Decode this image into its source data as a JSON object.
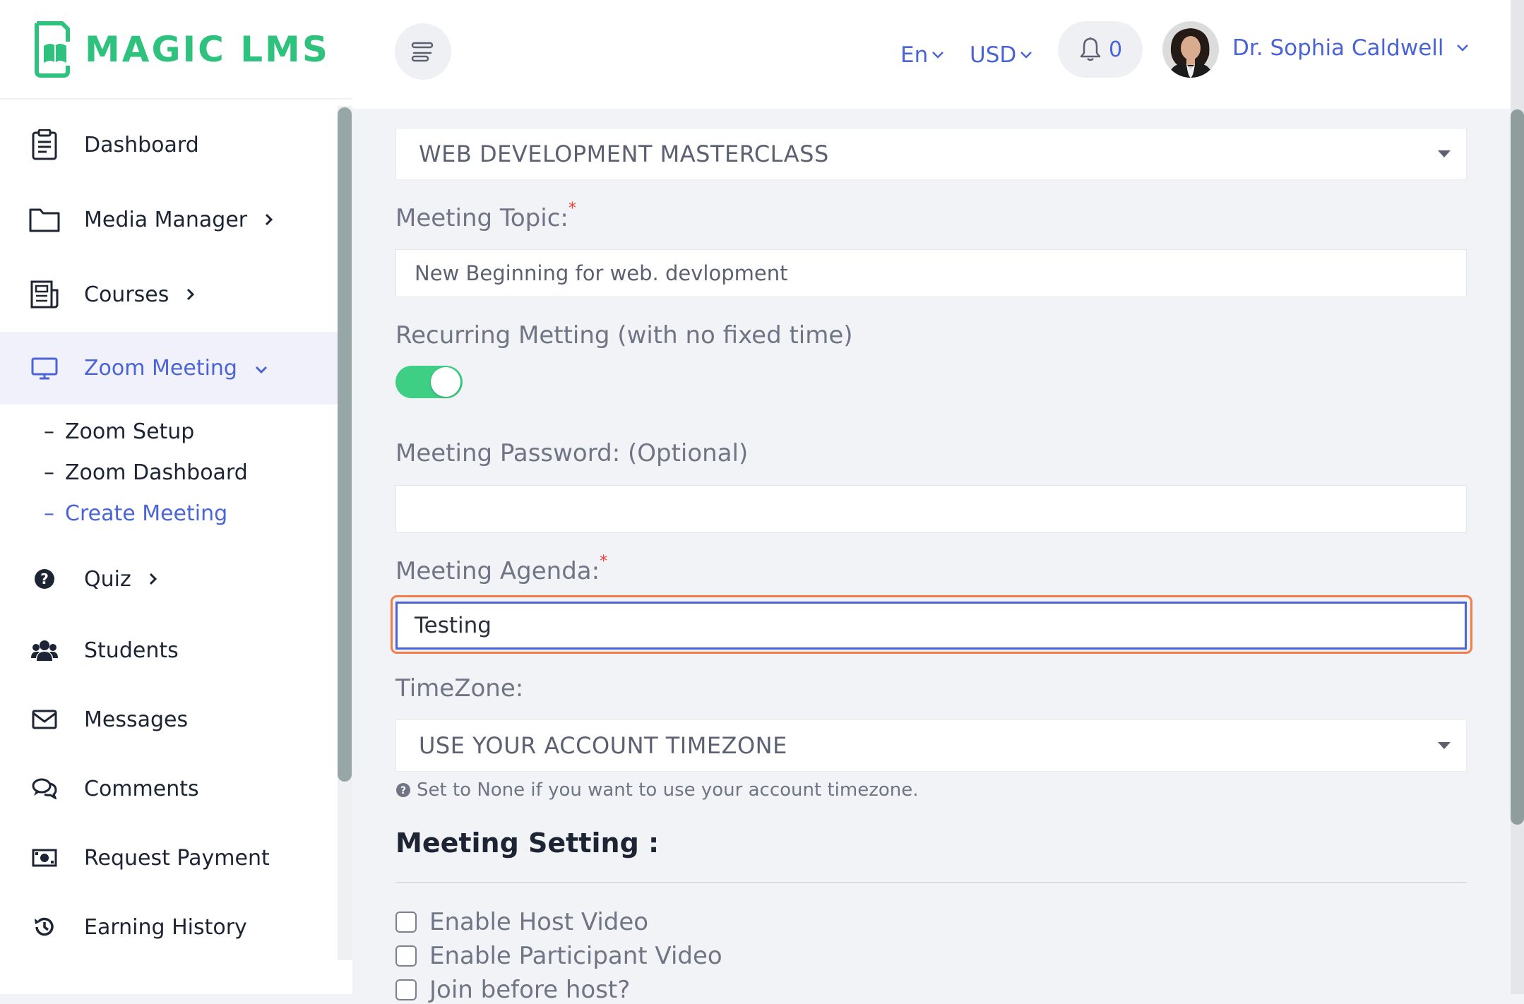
{
  "brand": {
    "name": "MAGIC LMS",
    "color": "#2ec27e"
  },
  "accent": "#4a64d8",
  "sidebar": {
    "items": [
      {
        "label": "Dashboard",
        "icon": "clipboard-icon"
      },
      {
        "label": "Media Manager",
        "icon": "folder-icon",
        "has_children": true
      },
      {
        "label": "Courses",
        "icon": "newspaper-icon",
        "has_children": true
      },
      {
        "label": "Zoom Meeting",
        "icon": "monitor-icon",
        "has_children": true,
        "expanded": true,
        "active": true
      },
      {
        "label": "Quiz",
        "icon": "question-circle-icon",
        "has_children": true
      },
      {
        "label": "Students",
        "icon": "users-icon"
      },
      {
        "label": "Messages",
        "icon": "envelope-icon"
      },
      {
        "label": "Comments",
        "icon": "comments-icon"
      },
      {
        "label": "Request Payment",
        "icon": "money-bill-icon"
      },
      {
        "label": "Earning History",
        "icon": "history-icon"
      }
    ],
    "zoom_submenu": [
      {
        "label": "Zoom Setup",
        "dash": "–"
      },
      {
        "label": "Zoom Dashboard",
        "dash": "–"
      },
      {
        "label": "Create Meeting",
        "dash": "–",
        "current": true
      }
    ]
  },
  "header": {
    "language": "En",
    "currency": "USD",
    "notification_count": "0",
    "user_name": "Dr. Sophia Caldwell"
  },
  "form": {
    "course_select": {
      "value": "WEB DEVELOPMENT MASTERCLASS"
    },
    "topic": {
      "label": "Meeting Topic:",
      "required_mark": "*",
      "value": "New Beginning for web. devlopment"
    },
    "recurring": {
      "label": "Recurring Metting (with no fixed time)",
      "enabled": true
    },
    "password": {
      "label": "Meeting Password: (Optional)",
      "value": ""
    },
    "agenda": {
      "label": "Meeting Agenda:",
      "required_mark": "*",
      "value": "Testing"
    },
    "timezone": {
      "label": "TimeZone:",
      "value": "USE YOUR ACCOUNT TIMEZONE",
      "hint": "Set to None if you want to use your account timezone."
    },
    "settings": {
      "title": "Meeting Setting :",
      "options": [
        {
          "label": "Enable Host Video",
          "checked": false
        },
        {
          "label": "Enable Participant Video",
          "checked": false
        },
        {
          "label": "Join before host?",
          "checked": false
        }
      ]
    }
  }
}
